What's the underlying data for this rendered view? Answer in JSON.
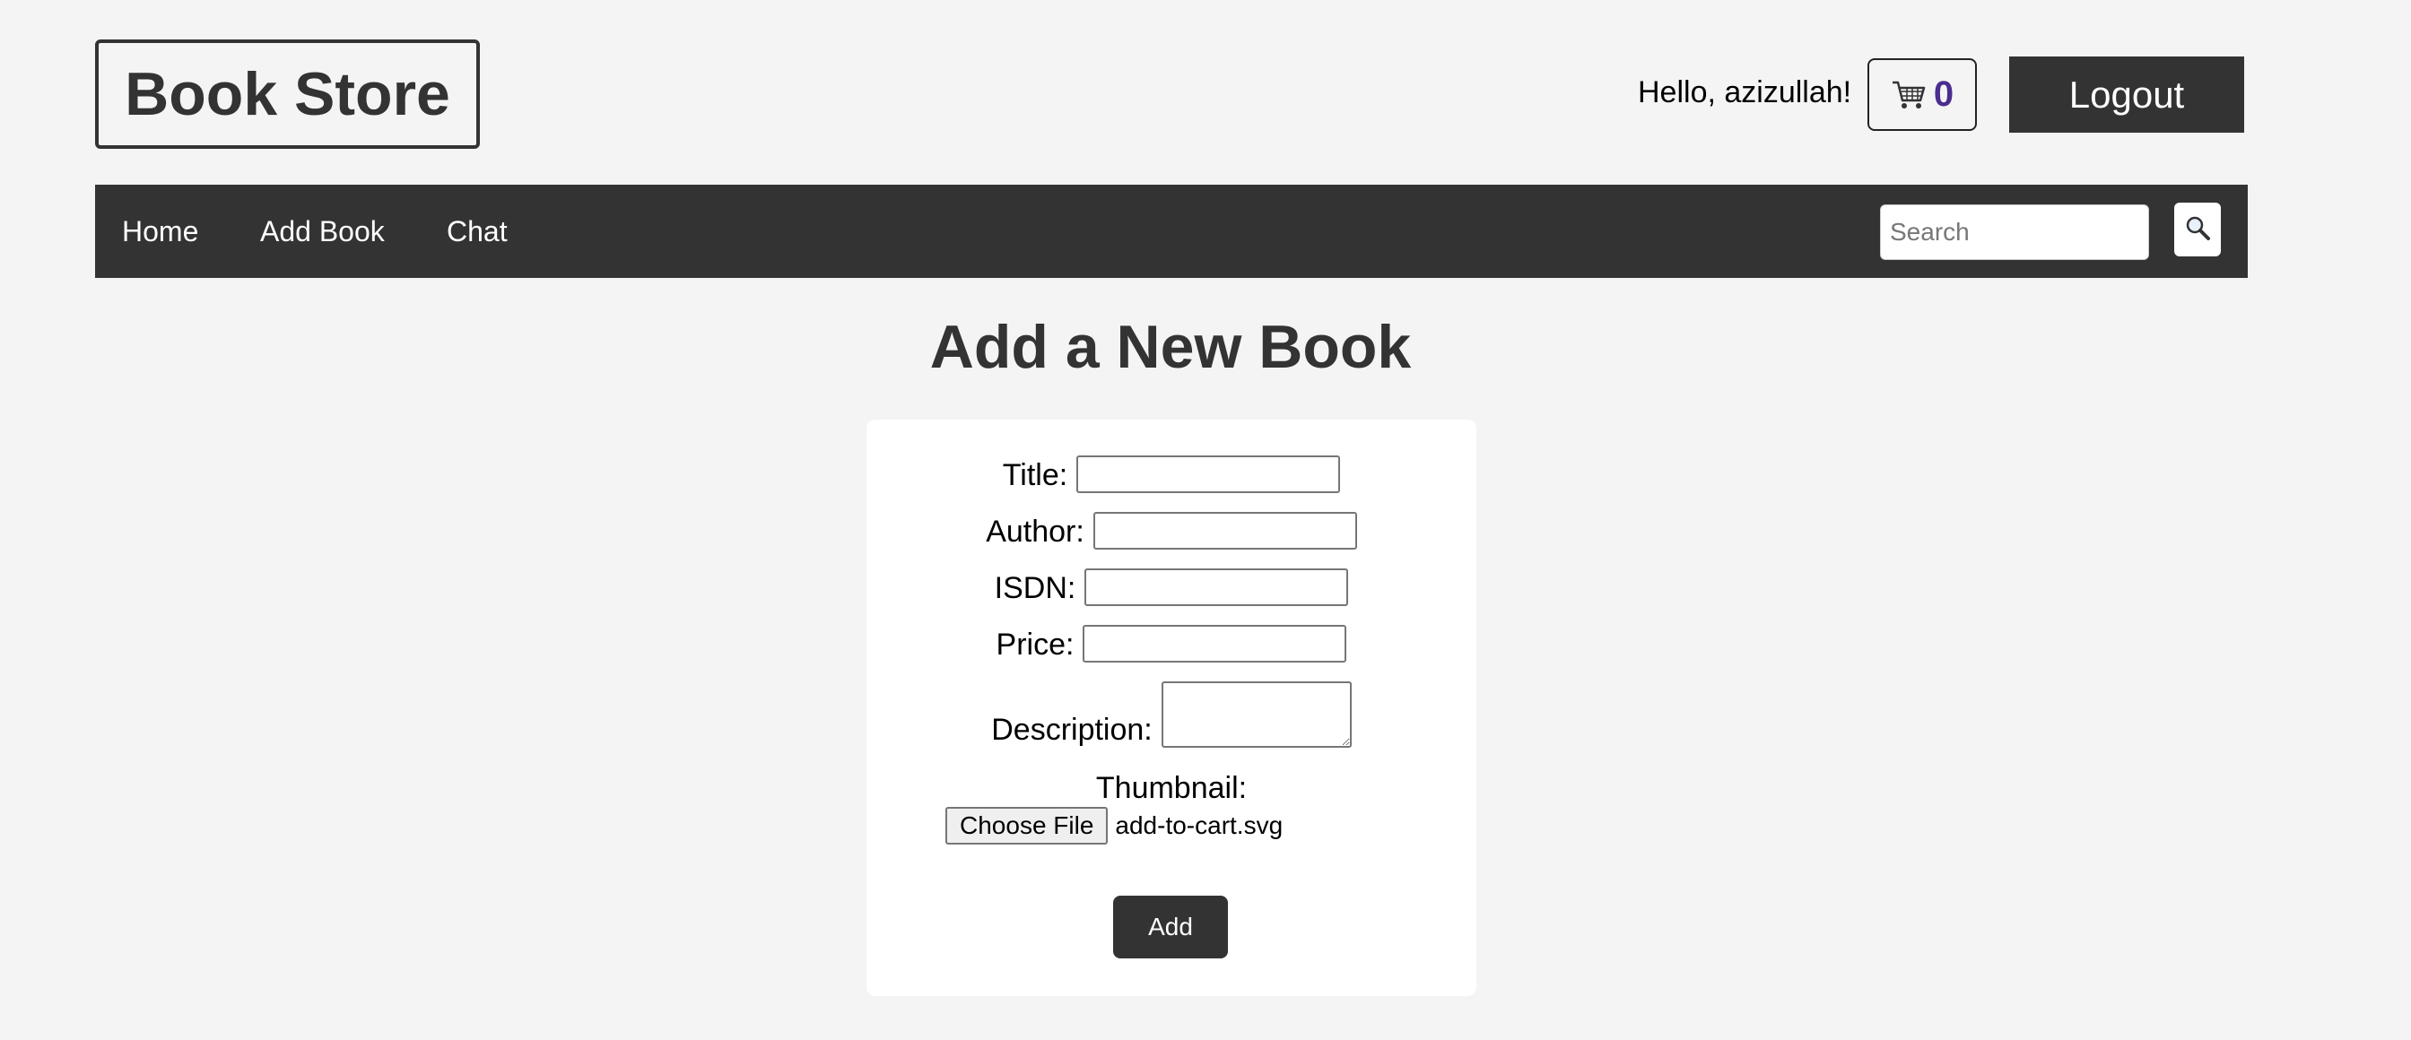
{
  "header": {
    "logo_text": "Book Store",
    "greeting": "Hello, azizullah!",
    "cart_count": "0",
    "cart_icon": "shopping-cart-icon",
    "logout_label": "Logout"
  },
  "nav": {
    "items": [
      {
        "label": "Home"
      },
      {
        "label": "Add Book"
      },
      {
        "label": "Chat"
      }
    ],
    "search_placeholder": "Search",
    "search_icon": "magnifier-icon"
  },
  "main": {
    "title": "Add a New Book",
    "form": {
      "fields": [
        {
          "label": "Title:",
          "value": ""
        },
        {
          "label": "Author:",
          "value": ""
        },
        {
          "label": "ISDN:",
          "value": ""
        },
        {
          "label": "Price:",
          "value": ""
        },
        {
          "label": "Description:",
          "value": ""
        }
      ],
      "thumbnail_label": "Thumbnail:",
      "choose_file_label": "Choose File",
      "file_name": "add-to-cart.svg",
      "submit_label": "Add"
    }
  },
  "colors": {
    "background": "#f4f4f4",
    "dark": "#333333",
    "cart_count": "#4a2d8f",
    "card": "#ffffff"
  }
}
